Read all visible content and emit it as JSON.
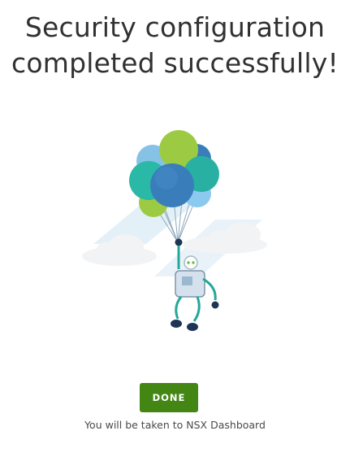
{
  "heading": {
    "line1": "Security configuration",
    "line2": "completed successfully!"
  },
  "illustration": {
    "icon": "robot-with-balloons-illustration"
  },
  "actions": {
    "done_label": "DONE"
  },
  "footer": {
    "hint_text": "You will be taken to NSX Dashboard"
  },
  "colors": {
    "accent_green": "#438613",
    "heading_text": "#313131",
    "body_text": "#4a4a4a"
  }
}
